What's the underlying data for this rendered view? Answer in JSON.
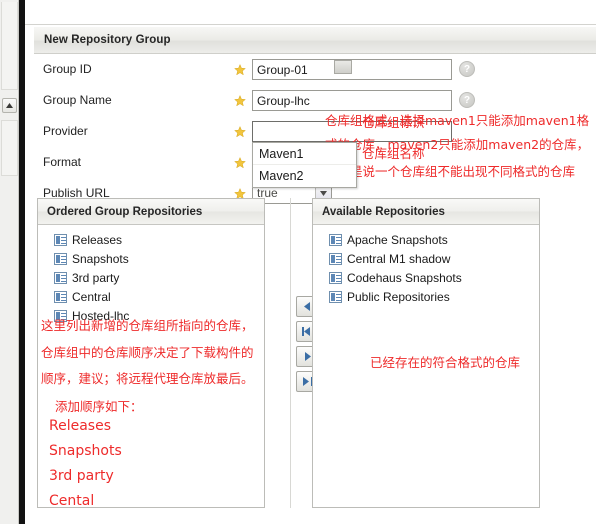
{
  "window": {
    "panel_title": "New Repository Group"
  },
  "form": {
    "rows": [
      {
        "label": "Group ID",
        "value": "Group-01",
        "required_icon": "star-icon",
        "help_icon": "help-icon",
        "annotation": "仓库组标识"
      },
      {
        "label": "Group Name",
        "value": "Group-lhc",
        "required_icon": "star-icon",
        "help_icon": "help-icon",
        "annotation": "仓库组名称"
      },
      {
        "label": "Provider",
        "value": "",
        "required_icon": "star-icon",
        "help_icon": "help-icon",
        "annotation": ""
      },
      {
        "label": "Format",
        "value": "",
        "required_icon": "star-icon",
        "help_icon": "help-icon",
        "annotation": ""
      },
      {
        "label": "Publish URL",
        "value": "true",
        "required_icon": "star-icon",
        "help_icon": "help-icon",
        "annotation": ""
      }
    ],
    "provider_dropdown": {
      "open": true,
      "options": [
        "Maven1",
        "Maven2"
      ]
    }
  },
  "annotations": {
    "provider_line1": "仓库组格式，选择maven1只能添加maven1格",
    "provider_line2": "式的仓库，maven2只能添加maven2的仓库，",
    "provider_line3": "也就是说一个仓库组不能出现不同格式的仓库",
    "left_line1": "这里列出新增的仓库组所指向的仓库，",
    "left_line2": "仓库组中的仓库顺序决定了下载构件的",
    "left_line3": "顺序，建议；将远程代理仓库放最后。",
    "left_line4": "添加顺序如下：",
    "order_items": [
      "Releases",
      "Snapshots",
      "3rd party",
      "Cental"
    ],
    "right_note": "已经存在的符合格式的仓库"
  },
  "ordered_group": {
    "header": "Ordered Group Repositories",
    "items": [
      {
        "label": "Releases",
        "icon": "repository-icon"
      },
      {
        "label": "Snapshots",
        "icon": "repository-icon"
      },
      {
        "label": "3rd party",
        "icon": "repository-icon"
      },
      {
        "label": "Central",
        "icon": "repository-icon"
      },
      {
        "label": "Hosted-lhc",
        "icon": "repository-icon"
      }
    ]
  },
  "available": {
    "header": "Available Repositories",
    "items": [
      {
        "label": "Apache Snapshots",
        "icon": "repository-icon"
      },
      {
        "label": "Central M1 shadow",
        "icon": "repository-icon"
      },
      {
        "label": "Codehaus Snapshots",
        "icon": "repository-icon"
      },
      {
        "label": "Public Repositories",
        "icon": "repository-icon"
      }
    ]
  },
  "transfer_buttons": [
    {
      "name": "move-left-button",
      "icon": "arrow-left-icon"
    },
    {
      "name": "move-all-left-button",
      "icon": "arrow-left-bar-icon"
    },
    {
      "name": "move-right-button",
      "icon": "arrow-right-icon"
    },
    {
      "name": "move-all-right-button",
      "icon": "arrow-right-bar-icon"
    }
  ],
  "colors": {
    "annotation_red": "#ee2b2b",
    "icon_blue": "#5d87b5",
    "star_gold": "#f2c53d"
  }
}
